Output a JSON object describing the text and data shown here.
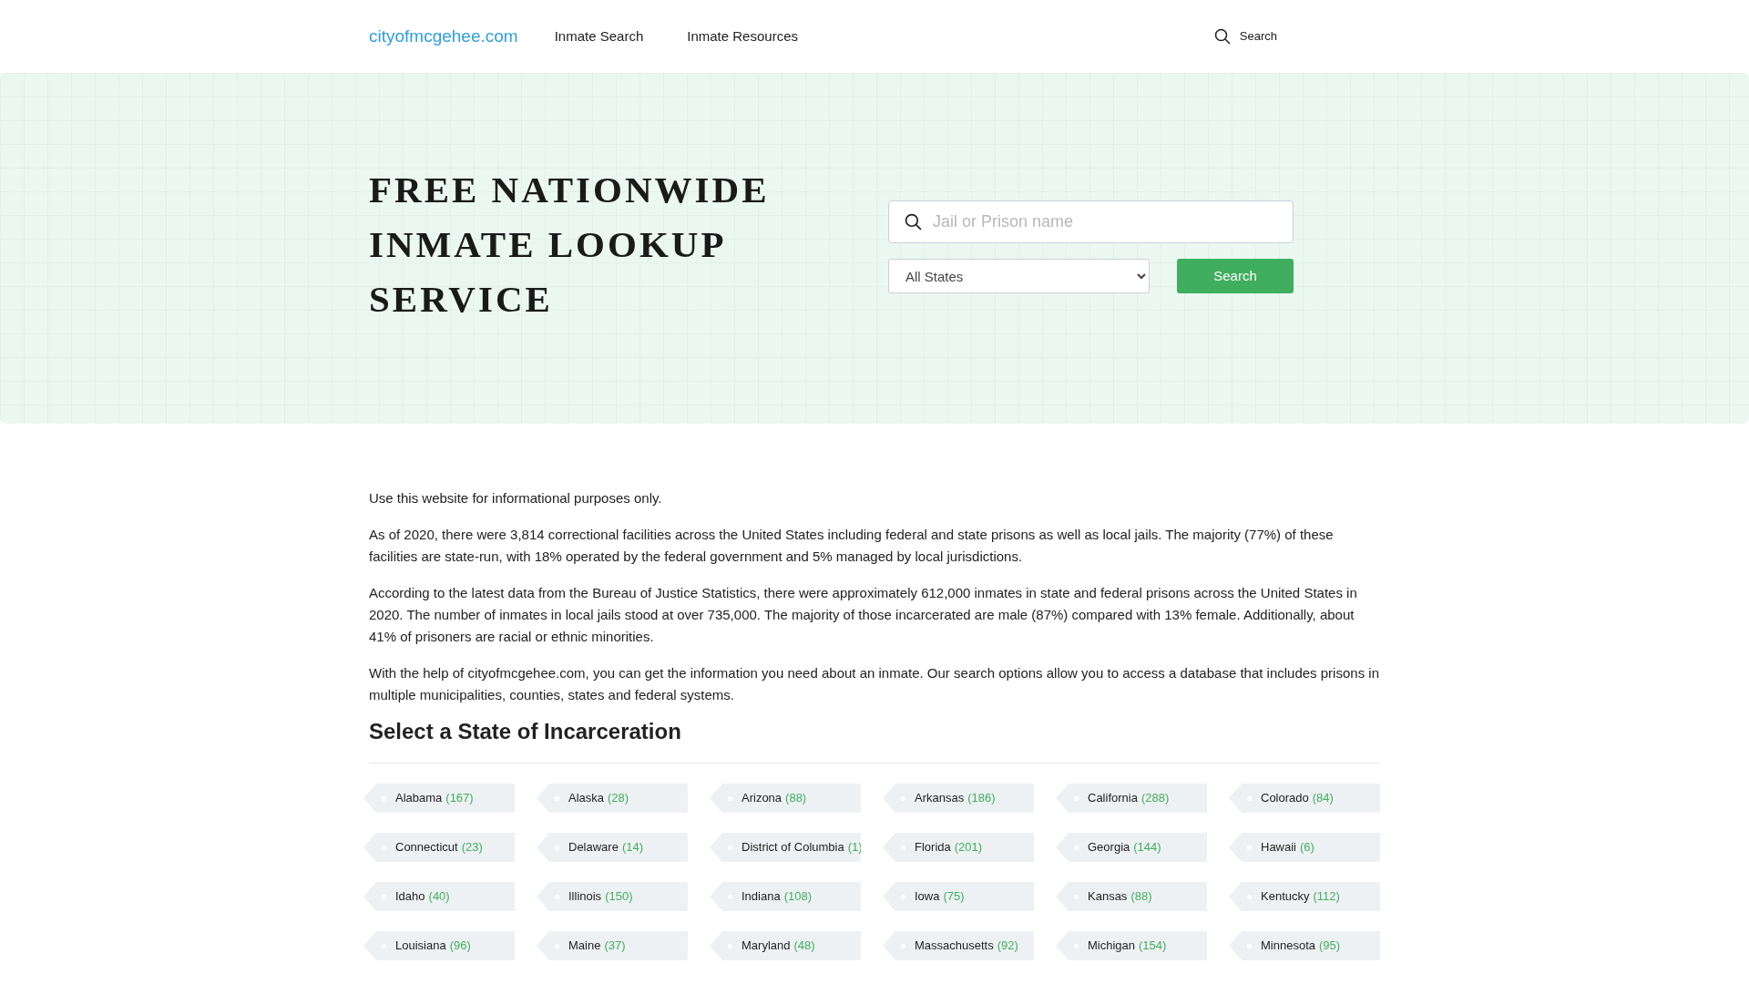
{
  "header": {
    "logo": "cityofmcgehee.com",
    "nav": [
      "Inmate Search",
      "Inmate Resources"
    ],
    "search_link": "Search"
  },
  "hero": {
    "title_lines": [
      "FREE NATIONWIDE",
      "INMATE LOOKUP",
      "SERVICE"
    ],
    "search": {
      "placeholder": "Jail or Prison name"
    },
    "state_select": {
      "value": "All States"
    },
    "button": "Search"
  },
  "intro": [
    "Use this website for informational purposes only.",
    "As of 2020, there were 3,814 correctional facilities across the United States including federal and state prisons as well as local jails. The majority (77%) of these facilities are state-run, with 18% operated by the federal government and 5% managed by local jurisdictions.",
    "According to the latest data from the Bureau of Justice Statistics, there were approximately 612,000 inmates in state and federal prisons across the United States in 2020. The number of inmates in local jails stood at over 735,000. The majority of those incarcerated are male (87%) compared with 13% female. Additionally, about 41% of prisoners are racial or ethnic minorities.",
    "With the help of cityofmcgehee.com, you can get the information you need about an inmate. Our search options allow you to access a database that includes prisons in multiple municipalities, counties, states and federal systems."
  ],
  "states_heading": "Select a State of Incarceration",
  "states": [
    {
      "name": "Alabama",
      "count": "(167)"
    },
    {
      "name": "Alaska",
      "count": "(28)"
    },
    {
      "name": "Arizona",
      "count": "(88)"
    },
    {
      "name": "Arkansas",
      "count": "(186)"
    },
    {
      "name": "California",
      "count": "(288)"
    },
    {
      "name": "Colorado",
      "count": "(84)"
    },
    {
      "name": "Connecticut",
      "count": "(23)"
    },
    {
      "name": "Delaware",
      "count": "(14)"
    },
    {
      "name": "District of Columbia",
      "count": "(1)"
    },
    {
      "name": "Florida",
      "count": "(201)"
    },
    {
      "name": "Georgia",
      "count": "(144)"
    },
    {
      "name": "Hawaii",
      "count": "(6)"
    },
    {
      "name": "Idaho",
      "count": "(40)"
    },
    {
      "name": "Illinois",
      "count": "(150)"
    },
    {
      "name": "Indiana",
      "count": "(108)"
    },
    {
      "name": "Iowa",
      "count": "(75)"
    },
    {
      "name": "Kansas",
      "count": "(88)"
    },
    {
      "name": "Kentucky",
      "count": "(112)"
    },
    {
      "name": "Louisiana",
      "count": "(96)"
    },
    {
      "name": "Maine",
      "count": "(37)"
    },
    {
      "name": "Maryland",
      "count": "(48)"
    },
    {
      "name": "Massachusetts",
      "count": "(92)"
    },
    {
      "name": "Michigan",
      "count": "(154)"
    },
    {
      "name": "Minnesota",
      "count": "(95)"
    }
  ]
}
